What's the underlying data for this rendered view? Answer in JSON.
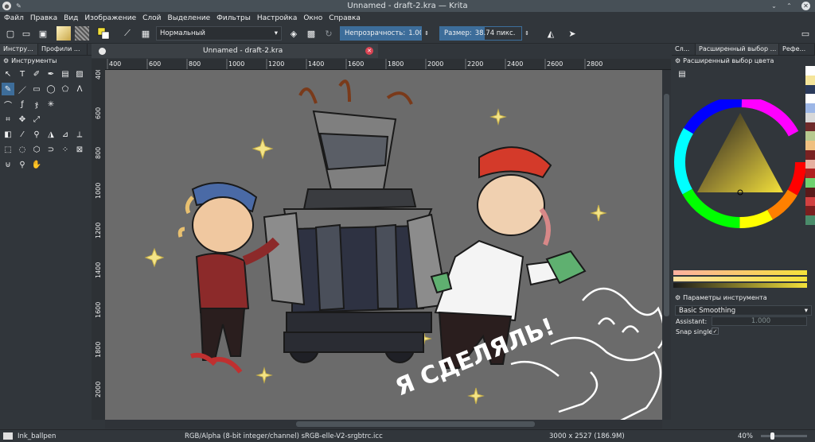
{
  "window": {
    "title": "Unnamed - draft-2.kra — Krita"
  },
  "menu": [
    "Файл",
    "Правка",
    "Вид",
    "Изображение",
    "Слой",
    "Выделение",
    "Фильтры",
    "Настройка",
    "Окно",
    "Справка"
  ],
  "toolbar": {
    "blend_mode": "Нормальный",
    "opacity_label": "Непрозрачность:",
    "opacity_value": "1.00",
    "opacity": 1.0,
    "size_label": "Размер:",
    "size_value": "38.74 пикс.",
    "size": 0.55
  },
  "left_dock": {
    "tabs": [
      "Инстру...",
      "Профили ..."
    ],
    "title": "Инструменты"
  },
  "document": {
    "tab_label": "Unnamed - draft-2.kra"
  },
  "ruler": {
    "h_ticks": [
      "400",
      "600",
      "800",
      "1000",
      "1200",
      "1400",
      "1600",
      "1800",
      "2000",
      "2200",
      "2400",
      "2600",
      "2800"
    ],
    "v_ticks": [
      "400",
      "600",
      "800",
      "1000",
      "1200",
      "1400",
      "1600",
      "1800",
      "2000"
    ]
  },
  "canvas": {
    "text": "Я СДЕЛЯЛЬ!"
  },
  "right_dock": {
    "tabs": [
      "Сл...",
      "Расширенный выбор ...",
      "Рефе..."
    ],
    "color_panel_title": "Расширенный выбор цвета",
    "tool_options_title": "Параметры инструмента",
    "smoothing": "Basic Smoothing",
    "assistant_label": "Assistant:",
    "assistant_value": "1.000",
    "snap_label": "Snap single:",
    "snap_check": "✓"
  },
  "swatches": [
    "#ffffff",
    "#f5e59a",
    "#2b3a5a",
    "#ffffff",
    "#9cb6e6",
    "#d8d8d8",
    "#6e2a2a",
    "#b7c98f",
    "#f0c080",
    "#7a2222",
    "#e6b0a0",
    "#b02020",
    "#6fd16f",
    "#5a1a1a",
    "#d24040",
    "#7a1e1e",
    "#4a8b6a"
  ],
  "status": {
    "brush": "Ink_ballpen",
    "color_space": "RGB/Alpha (8-bit integer/channel)  sRGB-elle-V2-srgbtrc.icc",
    "dimensions": "3000 x 2527 (186.9M)",
    "zoom": "40%"
  }
}
